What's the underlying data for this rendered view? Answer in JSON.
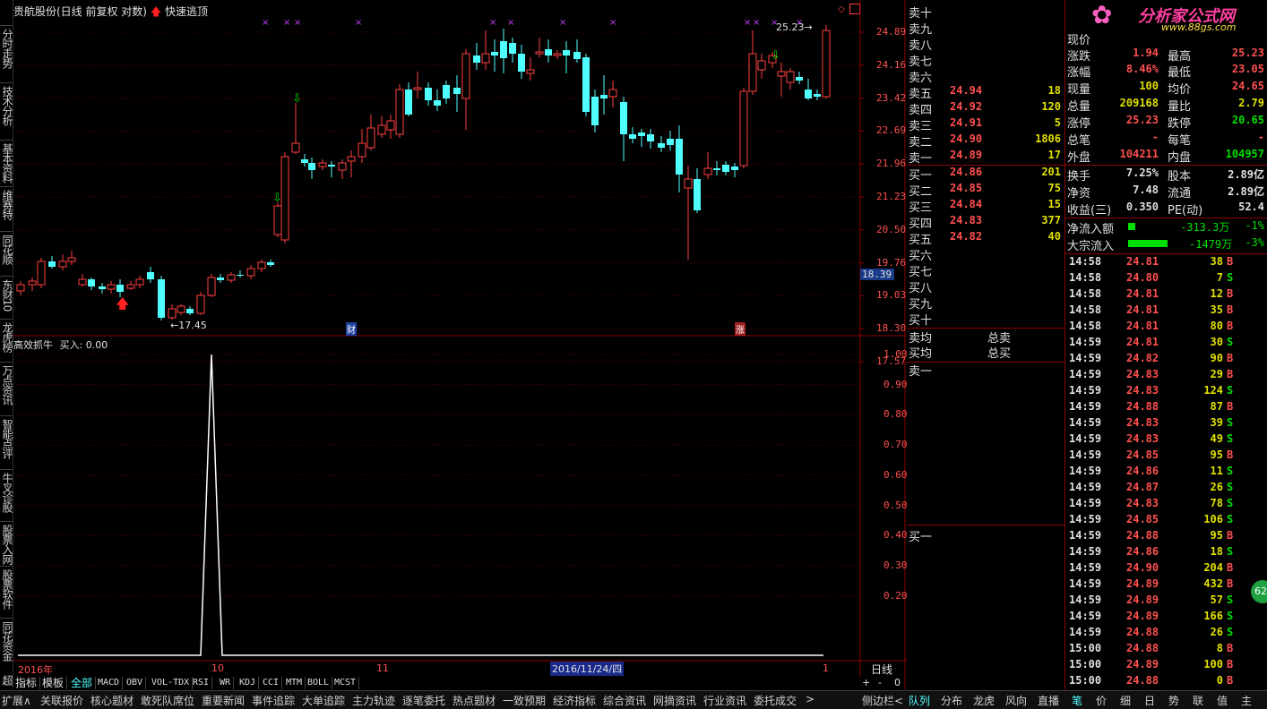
{
  "chart_title": {
    "stock": "贵航股份(日线 前复权 对数)",
    "quick": "快速逃顶"
  },
  "left_tabs": [
    "分时走势",
    "技术分析",
    "基本资料",
    "维赛特",
    "同花顺",
    "东财10",
    "龙虎榜",
    "万点资讯",
    "智能点评",
    "牛叉诊股",
    "股票入网",
    "股票软件",
    "同花资金",
    "超"
  ],
  "price_axis": [
    "24.89",
    "24.16",
    "23.42",
    "22.69",
    "21.96",
    "21.23",
    "20.50",
    "19.76",
    "19.03",
    "18.30",
    "17.57"
  ],
  "current_price_tag": "18.39",
  "chart_annotations": {
    "high": "25.23",
    "low": "17.45",
    "finance_tag": "财",
    "limit_tag": "涨"
  },
  "indicator": {
    "name": "高效抓牛",
    "value_label": "买入: 0.00",
    "axis": [
      "1.00",
      "0.90",
      "0.80",
      "0.70",
      "0.60",
      "0.50",
      "0.40",
      "0.30",
      "0.20"
    ]
  },
  "x_axis": {
    "labels": [
      "2016年",
      "10",
      "11",
      "1"
    ],
    "cursor_date": "2016/11/24/四",
    "period": "日线"
  },
  "indicator_tabs": [
    "指标",
    "模板",
    "全部",
    "MACD",
    "OBV",
    "VOL-TDX",
    "RSI",
    "WR",
    "KDJ",
    "CCI",
    "MTM",
    "BOLL",
    "MCST"
  ],
  "zoom_buttons": [
    "+",
    "-",
    "0"
  ],
  "order_book": {
    "sells": [
      {
        "label": "卖十",
        "price": "",
        "vol": ""
      },
      {
        "label": "卖九",
        "price": "",
        "vol": ""
      },
      {
        "label": "卖八",
        "price": "",
        "vol": ""
      },
      {
        "label": "卖七",
        "price": "",
        "vol": ""
      },
      {
        "label": "卖六",
        "price": "",
        "vol": ""
      },
      {
        "label": "卖五",
        "price": "24.94",
        "vol": "18"
      },
      {
        "label": "卖四",
        "price": "24.92",
        "vol": "120"
      },
      {
        "label": "卖三",
        "price": "24.91",
        "vol": "5"
      },
      {
        "label": "卖二",
        "price": "24.90",
        "vol": "1806"
      },
      {
        "label": "卖一",
        "price": "24.89",
        "vol": "17"
      }
    ],
    "buys": [
      {
        "label": "买一",
        "price": "24.86",
        "vol": "201"
      },
      {
        "label": "买二",
        "price": "24.85",
        "vol": "75"
      },
      {
        "label": "买三",
        "price": "24.84",
        "vol": "15"
      },
      {
        "label": "买四",
        "price": "24.83",
        "vol": "377"
      },
      {
        "label": "买五",
        "price": "24.82",
        "vol": "40"
      },
      {
        "label": "买六",
        "price": "",
        "vol": ""
      },
      {
        "label": "买七",
        "price": "",
        "vol": ""
      },
      {
        "label": "买八",
        "price": "",
        "vol": ""
      },
      {
        "label": "买九",
        "price": "",
        "vol": ""
      },
      {
        "label": "买十",
        "price": "",
        "vol": ""
      }
    ],
    "avg_sell": "卖均",
    "total_sell": "总卖",
    "avg_buy": "买均",
    "total_buy": "总买",
    "queue_sell": "卖一",
    "queue_buy": "买一"
  },
  "logo": {
    "name": "分析家公式网",
    "url": "www.88gs.com"
  },
  "quote": {
    "rows": [
      {
        "l1": "现价",
        "v1": "",
        "l2": "",
        "v2": ""
      },
      {
        "l1": "涨跌",
        "v1": "1.94",
        "l2": "最高",
        "v2": "25.23"
      },
      {
        "l1": "涨幅",
        "v1": "8.46%",
        "l2": "最低",
        "v2": "23.05"
      },
      {
        "l1": "现量",
        "v1": "100",
        "l2": "均价",
        "v2": "24.65"
      },
      {
        "l1": "总量",
        "v1": "209168",
        "l2": "量比",
        "v2": "2.79"
      },
      {
        "l1": "涨停",
        "v1": "25.23",
        "l2": "跌停",
        "v2": "20.65"
      },
      {
        "l1": "总笔",
        "v1": "-",
        "l2": "每笔",
        "v2": "-"
      },
      {
        "l1": "外盘",
        "v1": "104211",
        "l2": "内盘",
        "v2": "104957"
      },
      {
        "l1": "换手",
        "v1": "7.25%",
        "l2": "股本",
        "v2": "2.89亿"
      },
      {
        "l1": "净资",
        "v1": "7.48",
        "l2": "流通",
        "v2": "2.89亿"
      },
      {
        "l1": "收益(三)",
        "v1": "0.350",
        "l2": "PE(动)",
        "v2": "52.4"
      }
    ],
    "net_inflow": {
      "label": "净流入额",
      "value": "-313.3万",
      "pct": "-1%"
    },
    "block_inflow": {
      "label": "大宗流入",
      "value": "-1479万",
      "pct": "-3%"
    }
  },
  "ticks": [
    {
      "t": "14:58",
      "p": "24.81",
      "v": "38",
      "d": "B"
    },
    {
      "t": "14:58",
      "p": "24.80",
      "v": "7",
      "d": "S"
    },
    {
      "t": "14:58",
      "p": "24.81",
      "v": "12",
      "d": "B"
    },
    {
      "t": "14:58",
      "p": "24.81",
      "v": "35",
      "d": "B"
    },
    {
      "t": "14:58",
      "p": "24.81",
      "v": "80",
      "d": "B"
    },
    {
      "t": "14:59",
      "p": "24.81",
      "v": "30",
      "d": "S"
    },
    {
      "t": "14:59",
      "p": "24.82",
      "v": "90",
      "d": "B"
    },
    {
      "t": "14:59",
      "p": "24.83",
      "v": "29",
      "d": "B"
    },
    {
      "t": "14:59",
      "p": "24.83",
      "v": "124",
      "d": "S"
    },
    {
      "t": "14:59",
      "p": "24.88",
      "v": "87",
      "d": "B"
    },
    {
      "t": "14:59",
      "p": "24.83",
      "v": "39",
      "d": "S"
    },
    {
      "t": "14:59",
      "p": "24.83",
      "v": "49",
      "d": "S"
    },
    {
      "t": "14:59",
      "p": "24.85",
      "v": "95",
      "d": "B"
    },
    {
      "t": "14:59",
      "p": "24.86",
      "v": "11",
      "d": "S"
    },
    {
      "t": "14:59",
      "p": "24.87",
      "v": "26",
      "d": "S"
    },
    {
      "t": "14:59",
      "p": "24.83",
      "v": "78",
      "d": "S"
    },
    {
      "t": "14:59",
      "p": "24.85",
      "v": "106",
      "d": "S"
    },
    {
      "t": "14:59",
      "p": "24.88",
      "v": "95",
      "d": "B"
    },
    {
      "t": "14:59",
      "p": "24.86",
      "v": "18",
      "d": "S"
    },
    {
      "t": "14:59",
      "p": "24.90",
      "v": "204",
      "d": "B"
    },
    {
      "t": "14:59",
      "p": "24.89",
      "v": "432",
      "d": "B"
    },
    {
      "t": "14:59",
      "p": "24.89",
      "v": "57",
      "d": "S"
    },
    {
      "t": "14:59",
      "p": "24.89",
      "v": "166",
      "d": "S"
    },
    {
      "t": "14:59",
      "p": "24.88",
      "v": "26",
      "d": "S"
    },
    {
      "t": "15:00",
      "p": "24.88",
      "v": "8",
      "d": "B"
    },
    {
      "t": "15:00",
      "p": "24.89",
      "v": "100",
      "d": "B"
    },
    {
      "t": "15:00",
      "p": "24.88",
      "v": "0",
      "d": "B"
    }
  ],
  "float_badge": "62",
  "bottom_tabs": [
    "扩展∧",
    "关联报价",
    "核心题材",
    "敢死队席位",
    "重要新闻",
    "事件追踪",
    "大单追踪",
    "主力轨迹",
    "逐笔委托",
    "热点题材",
    "一致预期",
    "经济指标",
    "综合资讯",
    "网摘资讯",
    "行业资讯",
    "委托成交",
    ">"
  ],
  "side_label": "侧边栏<",
  "right_bottom_tabs": [
    "队列",
    "分布",
    "龙虎",
    "风向",
    "直播"
  ],
  "far_right_tabs": [
    "笔",
    "价",
    "细",
    "日",
    "势",
    "联",
    "值",
    "主"
  ],
  "colors": {
    "up": "#ff4040",
    "down": "#50ffff",
    "grid": "#8b0000",
    "white_line": "#ffffff"
  }
}
